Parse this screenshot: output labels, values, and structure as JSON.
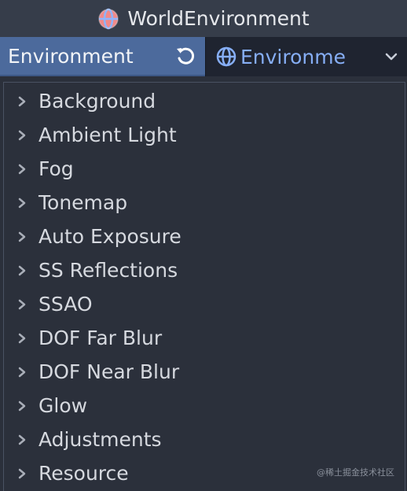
{
  "window": {
    "title": "WorldEnvironment"
  },
  "property": {
    "label": "Environment",
    "value": "Environme"
  },
  "sections": [
    {
      "label": "Background"
    },
    {
      "label": "Ambient Light"
    },
    {
      "label": "Fog"
    },
    {
      "label": "Tonemap"
    },
    {
      "label": "Auto Exposure"
    },
    {
      "label": "SS Reflections"
    },
    {
      "label": "SSAO"
    },
    {
      "label": "DOF Far Blur"
    },
    {
      "label": "DOF Near Blur"
    },
    {
      "label": "Glow"
    },
    {
      "label": "Adjustments"
    },
    {
      "label": "Resource"
    }
  ],
  "watermark": "@稀土掘金技术社区",
  "icons": {
    "title_icon": "world-environment-globe-icon",
    "revert_icon": "revert-icon",
    "resource_icon": "environment-globe-icon",
    "dropdown_icon": "chevron-down-icon",
    "section_icon": "chevron-right-icon"
  },
  "colors": {
    "header_bg": "#363d4a",
    "label_bg": "#4c6a9c",
    "picker_bg": "#1f2430",
    "picker_text": "#86aef5",
    "panel_bg": "#2b303b"
  }
}
